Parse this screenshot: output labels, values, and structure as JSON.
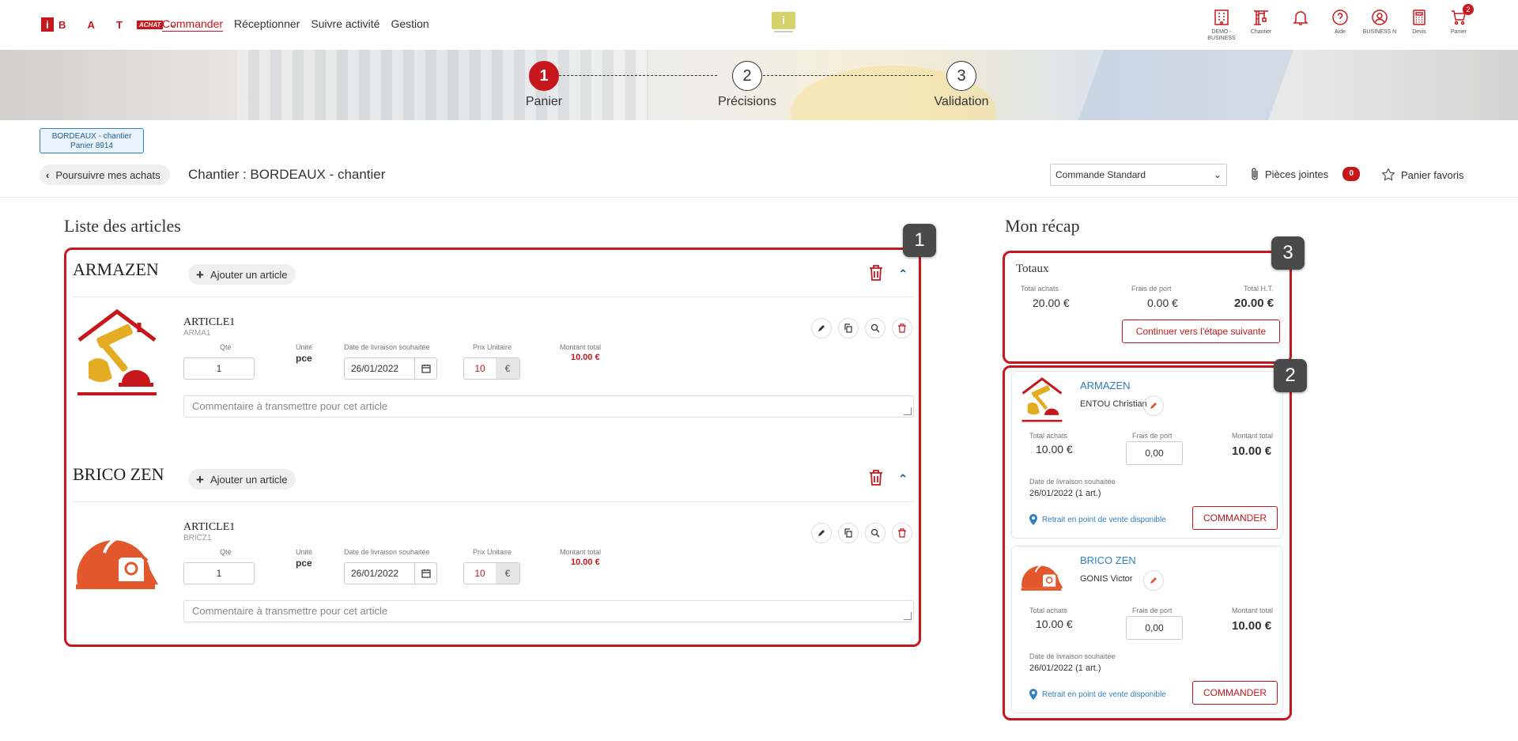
{
  "brand": {
    "letters": "B A T",
    "badge": "ACHAT"
  },
  "nav": {
    "items": [
      "Commander",
      "Réceptionner",
      "Suivre activité",
      "Gestion"
    ],
    "active": 0
  },
  "center_badge": "i",
  "right_nav": [
    {
      "icon": "building-icon",
      "label": "DEMO - BUSINESS"
    },
    {
      "icon": "crane-icon",
      "label": "Chantier"
    },
    {
      "icon": "bell-icon",
      "label": ""
    },
    {
      "icon": "help-icon",
      "label": "Aide"
    },
    {
      "icon": "user-icon",
      "label": "BUSINESS N"
    },
    {
      "icon": "calculator-icon",
      "label": "Devis"
    },
    {
      "icon": "cart-icon",
      "label": "Panier",
      "badge": "2"
    }
  ],
  "steps": [
    {
      "num": "1",
      "label": "Panier",
      "active": true
    },
    {
      "num": "2",
      "label": "Précisions",
      "active": false
    },
    {
      "num": "3",
      "label": "Validation",
      "active": false
    }
  ],
  "basket_tag": {
    "line1": "BORDEAUX - chantier",
    "line2": "Panier 8914"
  },
  "back_label": "Poursuivre mes achats",
  "chantier_title": "Chantier : BORDEAUX - chantier",
  "order_type": "Commande Standard",
  "attachments": {
    "label": "Pièces jointes",
    "count": "0"
  },
  "favorites_label": "Panier favoris",
  "articles_title": "Liste des articles",
  "recap_title": "Mon récap",
  "callouts": [
    "1",
    "2",
    "3"
  ],
  "labels": {
    "add_article": "Ajouter un article",
    "qty": "Qté",
    "unit": "Unité",
    "delivery": "Date de livraison souhaitée",
    "unit_price": "Prix Unitaire",
    "total": "Montant total",
    "comment_placeholder": "Commentaire à transmettre pour cet article",
    "currency": "€"
  },
  "vendors": [
    {
      "name": "ARMAZEN",
      "article": {
        "name": "ARTICLE1",
        "ref": "ARMA1",
        "qty": "1",
        "unit": "pce",
        "date": "26/01/2022",
        "price": "10",
        "total": "10.00 €"
      },
      "contact": "ENTOU Christian",
      "total_achats": "10.00 €",
      "frais_port": "0,00",
      "montant_total": "10.00 €",
      "delivery": "26/01/2022 (1 art.)"
    },
    {
      "name": "BRICO ZEN",
      "article": {
        "name": "ARTICLE1",
        "ref": "BRICZ1",
        "qty": "1",
        "unit": "pce",
        "date": "26/01/2022",
        "price": "10",
        "total": "10.00 €"
      },
      "contact": "GONIS Victor",
      "total_achats": "10.00 €",
      "frais_port": "0,00",
      "montant_total": "10.00 €",
      "delivery": "26/01/2022 (1 art.)"
    }
  ],
  "totaux": {
    "title": "Totaux",
    "total_achats_label": "Total achats",
    "total_achats": "20.00 €",
    "frais_port_label": "Frais de port",
    "frais_port": "0.00 €",
    "total_ht_label": "Total H.T.",
    "total_ht": "20.00 €",
    "continue_label": "Continuer vers l'étape suivante"
  },
  "recap_labels": {
    "total_achats": "Total achats",
    "frais_port": "Frais de port",
    "montant_total": "Montant total",
    "delivery": "Date de livraison souhaitée",
    "retrait": "Retrait en point de vente disponible",
    "commander": "COMMANDER"
  },
  "colors": {
    "accent": "#c8161d",
    "link": "#2f7fc1"
  }
}
